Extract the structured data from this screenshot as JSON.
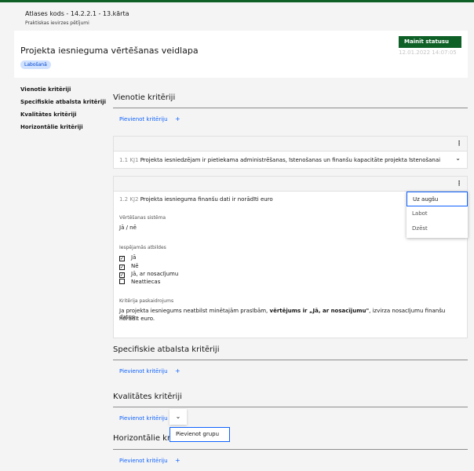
{
  "header": {
    "breadcrumb": "Atlases kods - 14.2.2.1 - 13.kārta",
    "subtitle": "Praktiskas ievirzes pētījumi"
  },
  "title_card": {
    "title": "Projekta iesnieguma vērtēšanas veidlapa",
    "status_badge": "Labošanā",
    "change_status_label": "Mainīt statusu",
    "timestamp": "12.01.2022 14:07:05"
  },
  "nav": {
    "items": [
      "Vienotie kritēriji",
      "Specifiskie atbalsta kritēriji",
      "Kvalitātes kritēriji",
      "Horizontālie kritēriji"
    ]
  },
  "sections": {
    "unified": {
      "title": "Vienotie kritēriji",
      "add_label": "Pievienot kritēriju"
    },
    "specific": {
      "title": "Specifiskie atbalsta kritēriji",
      "add_label": "Pievienot kritēriju"
    },
    "quality": {
      "title": "Kvalitātes kritēriji",
      "add_label": "Pievienot kritēriju"
    },
    "horizontal": {
      "title": "Horizontālie kritēriji",
      "add_label": "Pievienot kritēriju"
    }
  },
  "criteria": [
    {
      "number": "1.1 KJ1",
      "text": "Projekta iesniedzējam ir pietiekama administrēšanas, īstenošanas un finanšu kapacitāte projekta īstenošanai"
    },
    {
      "number": "1.2 KJ2",
      "text": "Projekta iesnieguma finanšu dati ir norādīti euro",
      "system_label": "Vērtēšanas sistēma",
      "system_value": "Jā / nē",
      "answers_label": "Iespējamās atbildes",
      "answers": [
        "Jā",
        "Nē",
        "Jā, ar nosacījumu",
        "Neattiecas"
      ],
      "explanation_label": "Kritērija paskaidrojums",
      "explanation_pre": "Ja projekta iesniegums neatbilst minētajām prasībām, ",
      "explanation_bold": "vērtējums ir „Jā, ar nosacījumu\"",
      "explanation_post": ", izvirza nosacījumu finanšu datus",
      "explanation_line2": "norādīt euro."
    }
  ],
  "context_menu": {
    "items": [
      "Uz augšu",
      "Labot",
      "Dzēst"
    ]
  },
  "group_popup": {
    "label": "Pievienot grupu"
  },
  "icons": {
    "plus": "+",
    "kebab": "⋮",
    "chevron": "⌄"
  }
}
